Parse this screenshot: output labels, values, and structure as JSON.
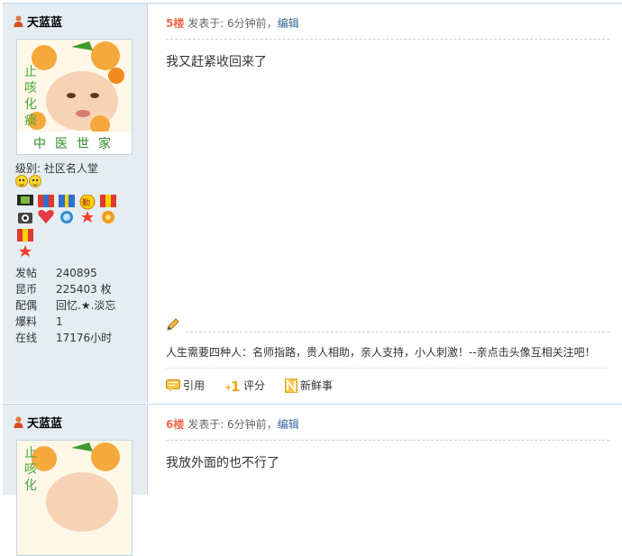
{
  "posts": [
    {
      "floor": "5楼",
      "meta": "发表于: 6分钟前，",
      "edit": "编辑",
      "body": "我又赶紧收回来了",
      "user": {
        "name": "天蓝蓝",
        "avatar_caption": "止咳化痰",
        "avatar_footer": "中医世家",
        "level_label": "级别:",
        "level_value": "社区名人堂",
        "stats": [
          {
            "label": "发帖",
            "value": "240895"
          },
          {
            "label": "昆币",
            "value": "225403 枚"
          },
          {
            "label": "配偶",
            "value": "回忆.★.淡忘"
          },
          {
            "label": "爆料",
            "value": "1"
          },
          {
            "label": "在线",
            "value": "17176小时"
          }
        ]
      },
      "signature": "人生需要四种人：名师指路，贵人相助，亲人支持，小人刺激！--亲点击头像互相关注吧！",
      "actions": {
        "quote": "引用",
        "rate": "评分",
        "news": "新鲜事"
      }
    },
    {
      "floor": "6楼",
      "meta": "发表于: 6分钟前，",
      "edit": "编辑",
      "body": "我放外面的也不行了",
      "user": {
        "name": "天蓝蓝",
        "avatar_caption": "止咳化"
      }
    }
  ],
  "colors": {
    "sidebar_bg": "#e5edf2",
    "floor": "#f26c4f",
    "link": "#336699",
    "border": "#c2d5e3"
  }
}
